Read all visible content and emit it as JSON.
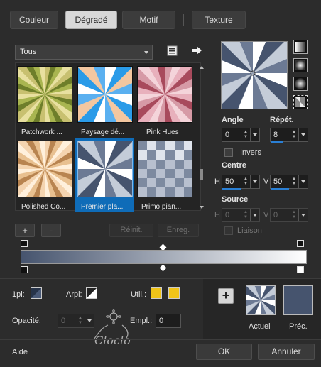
{
  "tabs": [
    {
      "label": "Couleur",
      "active": false
    },
    {
      "label": "Dégradé",
      "active": true
    },
    {
      "label": "Motif",
      "active": false
    },
    {
      "label": "Texture",
      "active": false
    }
  ],
  "category": {
    "selected": "Tous"
  },
  "gallery": {
    "items": [
      {
        "label": "Patchwork ...",
        "selected": false
      },
      {
        "label": "Paysage dé...",
        "selected": false
      },
      {
        "label": "Pink Hues",
        "selected": false
      },
      {
        "label": "Polished Co...",
        "selected": false
      },
      {
        "label": "Premier pla...",
        "selected": true
      },
      {
        "label": "Primo pian...",
        "selected": false
      }
    ]
  },
  "gallery_buttons": {
    "add": "+",
    "remove": "-",
    "reset": "Réinit.",
    "save": "Enreg."
  },
  "params": {
    "angle_label": "Angle",
    "angle_value": "0",
    "repeat_label": "Répét.",
    "repeat_value": "8",
    "invert_label": "Invers",
    "center_label": "Centre",
    "center_h_label": "H",
    "center_h_value": "50",
    "center_v_label": "V",
    "center_v_value": "50",
    "source_label": "Source",
    "source_h_label": "H",
    "source_h_value": "0",
    "source_v_label": "V",
    "source_v_value": "0",
    "link_label": "Liaison"
  },
  "bottom": {
    "first_plan_label": "1pl:",
    "back_plan_label": "Arpl:",
    "use_label": "Util.:",
    "opacity_label": "Opacité:",
    "opacity_value": "0",
    "location_label": "Empl.:",
    "location_value": "0",
    "current_label": "Actuel",
    "previous_label": "Préc.",
    "add_button": "+"
  },
  "watermark": {
    "text": "Cloclo"
  },
  "footer": {
    "help": "Aide",
    "ok": "OK",
    "cancel": "Annuler"
  },
  "colors": {
    "accent_blue": "#2a7fd4",
    "selection_blue": "#0f6cb8",
    "user_swatch_yellow": "#f0c419",
    "previous_swatch": "#46546e"
  },
  "icons": {
    "doc": "document-list-icon",
    "arrow": "arrow-right-icon"
  }
}
